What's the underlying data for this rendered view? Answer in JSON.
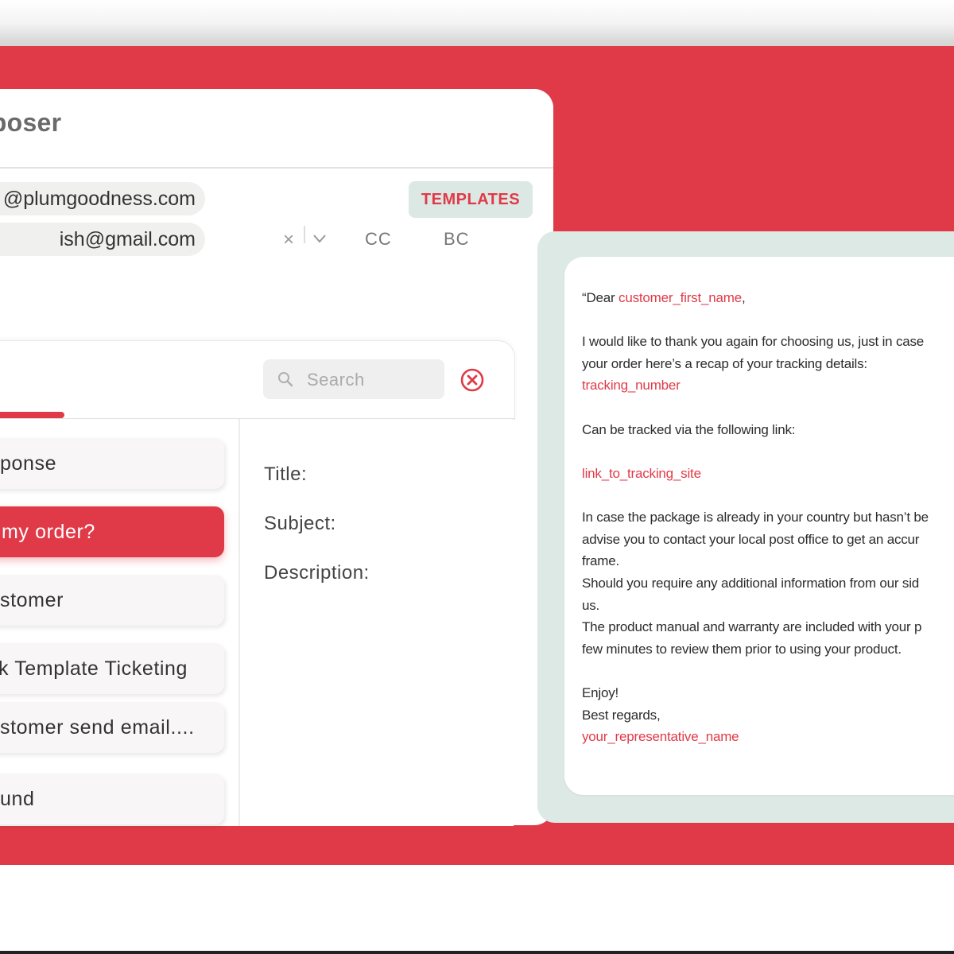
{
  "composer": {
    "title": "mposer",
    "from_email": "@plumgoodness.com",
    "to_email": "ish@gmail.com",
    "templates_label": "TEMPLATES",
    "clear_glyph": "×",
    "cc_label": "CC",
    "bc_label": "BC"
  },
  "picker": {
    "search_placeholder": "Search",
    "items": [
      {
        "label": "ponse",
        "active": false
      },
      {
        "label": "my order?",
        "active": true
      },
      {
        "label": "stomer",
        "active": false
      },
      {
        "label": "k Template Ticketing",
        "active": false
      },
      {
        "label": "stomer send email....",
        "active": false
      },
      {
        "label": "und",
        "active": false
      }
    ],
    "fields": {
      "title": "Title:",
      "subject": "Subject:",
      "description": "Description:"
    }
  },
  "preview": {
    "line1_prefix": "“Dear ",
    "var_first_name": "customer_first_name",
    "line1_suffix": ",",
    "para1_a": "I would like to thank you again for choosing us, just in case",
    "para1_b": "your order here’s a recap of your tracking details:",
    "var_tracking": "tracking_number",
    "para2": "Can be tracked via the following link:",
    "var_link": "link_to_tracking_site",
    "para3_a": "In case the package is already in your country but hasn’t be",
    "para3_b": "advise you to contact your local post office to get an accur",
    "para3_c": "frame.",
    "para3_d": "Should you require any additional information from our sid",
    "para3_e": "us.",
    "para3_f": "The product manual and warranty are included with your p",
    "para3_g": "few minutes to review them prior to using your product.",
    "enjoy": "Enjoy!",
    "regards": "Best regards,",
    "var_rep": "your_representative_name"
  },
  "colors": {
    "accent": "#e03a48",
    "panel_mint": "#dde9e4"
  },
  "icons": [
    "chevron-down-icon",
    "search-icon",
    "close-circle-icon"
  ]
}
